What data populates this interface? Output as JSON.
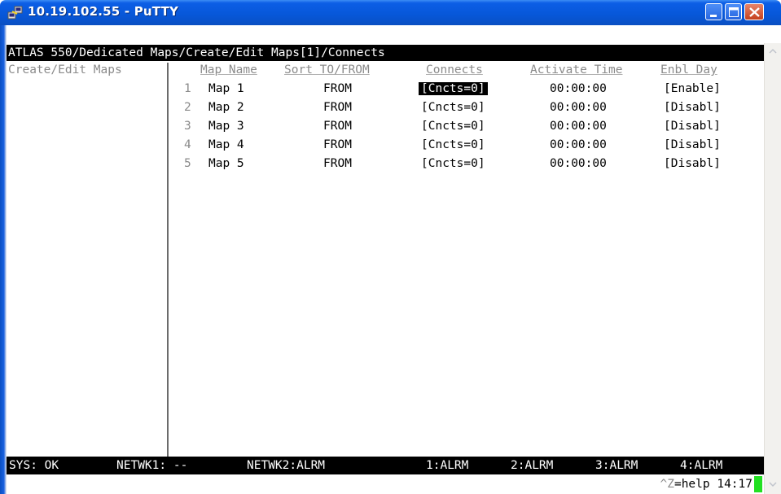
{
  "window": {
    "title": "10.19.102.55 - PuTTY"
  },
  "terminal": {
    "header": "ATLAS 550/Dedicated Maps/Create/Edit Maps[1]/Connects",
    "sidebar_label": "Create/Edit Maps",
    "columns": {
      "map_name": "Map Name",
      "sort": "Sort TO/FROM",
      "connects": "Connects",
      "activate_time": "Activate Time",
      "enbl_day": "Enbl Day"
    },
    "rows": [
      {
        "num": "1",
        "name": "Map 1",
        "sort": "FROM",
        "connects": "[Cncts=0]",
        "time": "00:00:00",
        "day": "[Enable]"
      },
      {
        "num": "2",
        "name": "Map 2",
        "sort": "FROM",
        "connects": "[Cncts=0]",
        "time": "00:00:00",
        "day": "[Disabl]"
      },
      {
        "num": "3",
        "name": "Map 3",
        "sort": "FROM",
        "connects": "[Cncts=0]",
        "time": "00:00:00",
        "day": "[Disabl]"
      },
      {
        "num": "4",
        "name": "Map 4",
        "sort": "FROM",
        "connects": "[Cncts=0]",
        "time": "00:00:00",
        "day": "[Disabl]"
      },
      {
        "num": "5",
        "name": "Map 5",
        "sort": "FROM",
        "connects": "[Cncts=0]",
        "time": "00:00:00",
        "day": "[Disabl]"
      }
    ],
    "status": {
      "sys": "SYS: OK",
      "netwk1": "NETWK1: --",
      "netwk2": "NETWK2:ALRM",
      "p1": "1:ALRM",
      "p2": "2:ALRM",
      "p3": "3:ALRM",
      "p4": "4:ALRM"
    },
    "help": {
      "key": "^Z",
      "text": "=help 14:17"
    }
  },
  "colors": {
    "title_bar": "#0757d8",
    "cursor": "#22e022",
    "dim_text": "#8a8a8a"
  },
  "icons": {
    "app": "putty-icon",
    "minimize": "minimize-icon",
    "maximize": "maximize-icon",
    "close": "close-icon"
  }
}
